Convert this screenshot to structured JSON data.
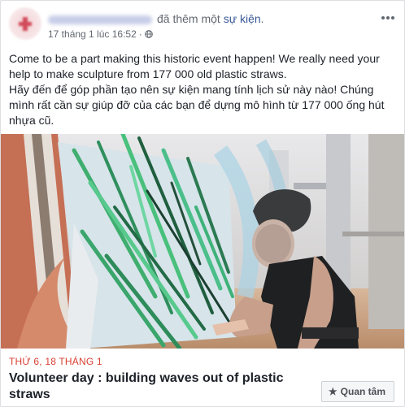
{
  "post": {
    "author_name": "",
    "action": "đã thêm một",
    "event_link": "sự kiện",
    "action_end": ".",
    "timestamp": "17 tháng 1 lúc 16:52",
    "separator": "·",
    "privacy_icon": "globe-icon",
    "more_icon": "ellipsis-icon",
    "text_en": "Come to be a part making this historic event happen! We really need your help to make sculpture from 177 000 old plastic straws.",
    "text_vi": "Hãy đến để góp phần tạo nên sự kiện mang tính lịch sử này nào! Chúng mình rất cần sự giúp đỡ của các bạn để dựng mô hình từ 177 000 ống hút nhựa cũ."
  },
  "event": {
    "date": "THỨ 6, 18 THÁNG 1",
    "title": "Volunteer day : building waves out of plastic straws",
    "interest_label": "Quan tâm",
    "interest_icon": "star-icon"
  },
  "colors": {
    "link": "#385898",
    "date_red": "#d93f33",
    "text": "#1d2129",
    "meta": "#616770"
  }
}
